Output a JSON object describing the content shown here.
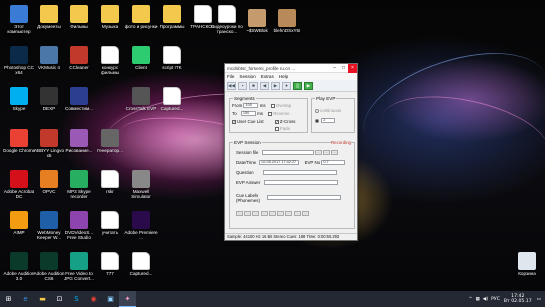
{
  "desktop": {
    "icons": [
      {
        "label": "Этот компьютер",
        "icon": "computer-icon",
        "color": "#3a7bd5"
      },
      {
        "label": "Документы",
        "icon": "folder-icon",
        "color": "#f2c94c"
      },
      {
        "label": "Фильмы",
        "icon": "folder-icon",
        "color": "#f2c94c"
      },
      {
        "label": "Музыка",
        "icon": "folder-icon",
        "color": "#f2c94c"
      },
      {
        "label": "фото и рисунки",
        "icon": "folder-icon",
        "color": "#f2c94c"
      },
      {
        "label": "Программы",
        "icon": "folder-icon",
        "color": "#f2c94c"
      },
      {
        "label": "ТРАНСКО...",
        "icon": "document-icon",
        "color": "#ffffff"
      },
      {
        "label": "Видеоуроки по транско...",
        "icon": "document-icon",
        "color": "#ffffff"
      },
      {
        "label": "~$SWBlok",
        "icon": "image-icon",
        "color": "#c59b6d"
      },
      {
        "label": "blehnDSxY5I",
        "icon": "image-icon",
        "color": "#b88a5a"
      },
      {
        "label": "Photoshop CC x64",
        "icon": "photoshop-icon",
        "color": "#0b2a4a"
      },
      {
        "label": "VKMusic 4",
        "icon": "vkmusic-icon",
        "color": "#4a76a8"
      },
      {
        "label": "CCleaner",
        "icon": "ccleaner-icon",
        "color": "#c0392b"
      },
      {
        "label": "конкурс фильмы",
        "icon": "document-icon",
        "color": "#ffffff"
      },
      {
        "label": "Client",
        "icon": "client-icon",
        "color": "#2ecc71"
      },
      {
        "label": "script ITK",
        "icon": "document-icon",
        "color": "#ffffff"
      },
      {
        "label": "Skype",
        "icon": "skype-icon",
        "color": "#00aff0"
      },
      {
        "label": "DEXP",
        "icon": "dexp-icon",
        "color": "#333333"
      },
      {
        "label": "Совместим...",
        "icon": "floppy-icon",
        "color": "#2c3e90"
      },
      {
        "label": "CrossTalk EVP",
        "icon": "crosstalk-icon",
        "color": "#555555"
      },
      {
        "label": "Captured...",
        "icon": "document-icon",
        "color": "#ffffff"
      },
      {
        "label": "Google Chrome",
        "icon": "chrome-icon",
        "color": "#e94235"
      },
      {
        "label": "ABBYY Lingvo x5",
        "icon": "lingvo-icon",
        "color": "#c0392b"
      },
      {
        "label": "Рисование...",
        "icon": "paint-icon",
        "color": "#9b59b6"
      },
      {
        "label": "Генератор...",
        "icon": "generator-icon",
        "color": "#666666"
      },
      {
        "label": "Adobe Acrobat DC",
        "icon": "acrobat-icon",
        "color": "#d4111b"
      },
      {
        "label": "OPVC",
        "icon": "opvc-icon",
        "color": "#e67e22"
      },
      {
        "label": "MP3 Skype recorder",
        "icon": "recorder-icon",
        "color": "#27ae60"
      },
      {
        "label": "rskr",
        "icon": "document-icon",
        "color": "#ffffff"
      },
      {
        "label": "Maxwell Simulator",
        "icon": "maxwell-icon",
        "color": "#888888"
      },
      {
        "label": "AIMP",
        "icon": "aimp-icon",
        "color": "#f39c12"
      },
      {
        "label": "WebMoney Keeper W...",
        "icon": "webmoney-icon",
        "color": "#1f5fa8"
      },
      {
        "label": "DVDVideoS... Free Studio",
        "icon": "dvd-icon",
        "color": "#8e44ad"
      },
      {
        "label": "учитать",
        "icon": "document-icon",
        "color": "#ffffff"
      },
      {
        "label": "Adobe Premiere ...",
        "icon": "premiere-icon",
        "color": "#2a0a4a"
      },
      {
        "label": "Adobe Audition 3.0",
        "icon": "audition-icon",
        "color": "#0a3a2a"
      },
      {
        "label": "Adobe Audition CS6",
        "icon": "audition-icon",
        "color": "#0a3a2a"
      },
      {
        "label": "Free Video to JPG Convert...",
        "icon": "video-jpg-icon",
        "color": "#16a085"
      },
      {
        "label": "777",
        "icon": "document-icon",
        "color": "#ffffff"
      },
      {
        "label": "Captured...",
        "icon": "document-icon",
        "color": "#ffffff"
      },
      {
        "label": "Корзина",
        "icon": "recycle-bin-icon",
        "color": "#e0e6ee"
      }
    ]
  },
  "window": {
    "title": "mcdnbtsr_forsemi_profile ru.cn ...",
    "menu": [
      "File",
      "Session",
      "Extras",
      "Help"
    ],
    "segments": {
      "label": "Segments",
      "from_label": "From",
      "from_value": "100",
      "from_unit": "ms",
      "to_label": "To",
      "to_value": "150",
      "to_unit": "ms",
      "user_cue_list": "User Cue List",
      "overlap": "Overlap",
      "reverse": "Reverse",
      "z_cross": "Z-Cross",
      "fade": "Fade"
    },
    "play_evp": {
      "label": "Play EVP",
      "continuous": "continuous",
      "count_value": "2"
    },
    "evp_session": {
      "label": "EVP Session",
      "status": "Recording",
      "session_file_label": "Session file",
      "datetime_label": "Date/Time",
      "datetime_value": "02.05.2017 17:42:27",
      "evp_no_label": "EVP No",
      "evp_no_value": "0.7",
      "question_label": "Question",
      "evp_answer_label": "EVP Answer",
      "cue_labels_label": "Cue Labels (Phonemes)"
    },
    "status_bar": "Sample: 44100 Hz  16 Bit  Stereo  Cues: 188  Time: 0:00:50.293"
  },
  "taskbar": {
    "lang": "РУС",
    "time": "17:42",
    "date": "Вт 02.05.17"
  }
}
